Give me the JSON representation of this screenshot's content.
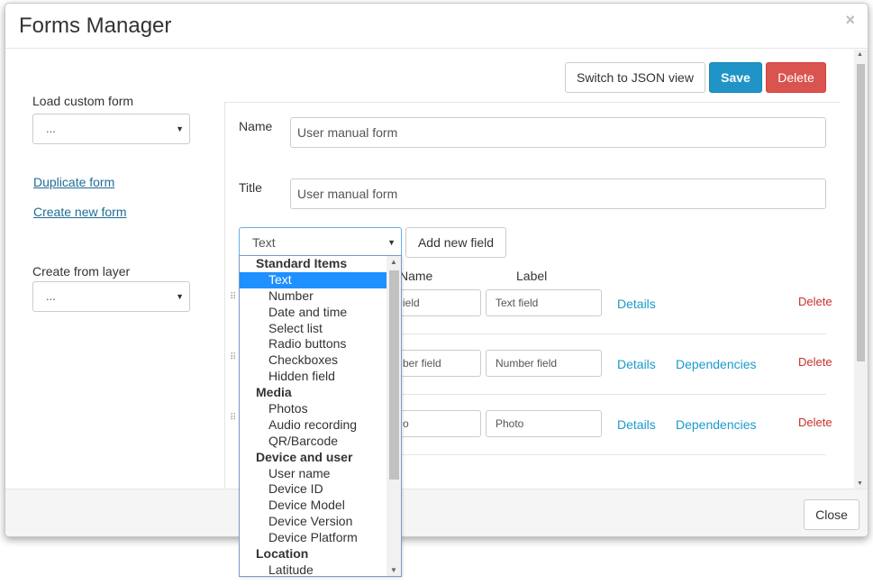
{
  "dialog": {
    "title": "Forms Manager",
    "close_symbol": "×"
  },
  "toolbar": {
    "json_view_label": "Switch to JSON view",
    "save_label": "Save",
    "delete_label": "Delete"
  },
  "sidebar": {
    "load_custom_form_label": "Load custom form",
    "load_custom_form_value": "...",
    "duplicate_form_link": "Duplicate form",
    "create_new_form_link": "Create new form",
    "create_from_layer_label": "Create from layer",
    "create_from_layer_value": "..."
  },
  "form": {
    "name_label": "Name",
    "name_value": "User manual form",
    "title_label": "Title",
    "title_value": "User manual form",
    "field_type_value": "Text",
    "add_field_label": "Add new field"
  },
  "fields_table": {
    "col_name": "Name",
    "col_label": "Label",
    "rows": [
      {
        "name_visible": "ield",
        "label": "Text field",
        "details": "Details",
        "dependencies": "",
        "delete": "Delete"
      },
      {
        "name_visible": "ber field",
        "label": "Number field",
        "details": "Details",
        "dependencies": "Dependencies",
        "delete": "Delete"
      },
      {
        "name_visible": "o",
        "label": "Photo",
        "details": "Details",
        "dependencies": "Dependencies",
        "delete": "Delete"
      }
    ]
  },
  "field_type_dropdown": {
    "groups": [
      {
        "label": "Standard Items",
        "options": [
          "Text",
          "Number",
          "Date and time",
          "Select list",
          "Radio buttons",
          "Checkboxes",
          "Hidden field"
        ]
      },
      {
        "label": "Media",
        "options": [
          "Photos",
          "Audio recording",
          "QR/Barcode"
        ]
      },
      {
        "label": "Device and user",
        "options": [
          "User name",
          "Device ID",
          "Device Model",
          "Device Version",
          "Device Platform"
        ]
      },
      {
        "label": "Location",
        "options": [
          "Latitude"
        ]
      }
    ],
    "selected": "Text"
  },
  "footer": {
    "close_label": "Close"
  },
  "colors": {
    "primary": "#2094c7",
    "danger": "#d9534f",
    "link": "#1a9bc9",
    "delete_text": "#c9302c",
    "selection": "#1e90ff"
  }
}
